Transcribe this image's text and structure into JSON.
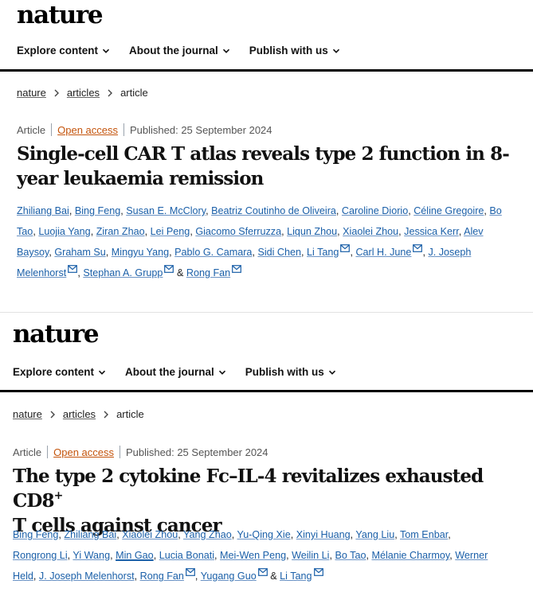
{
  "panels": [
    {
      "logo": "nature",
      "nav": [
        "Explore content",
        "About the journal",
        "Publish with us"
      ],
      "breadcrumb": [
        "nature",
        "articles",
        "article"
      ],
      "article_type": "Article",
      "access": "Open access",
      "published": "Published: 25 September 2024",
      "title": "Single-cell CAR T atlas reveals type 2 function in 8-year leukaemia remission",
      "authors_line1": [
        "Zhiliang Bai",
        "Bing Feng",
        "Susan E. McClory",
        "Beatriz Coutinho de Oliveira",
        "Caroline Diorio",
        "Céline Gregoire",
        "Bo"
      ],
      "authors_line2": [
        "Tao",
        "Luojia Yang",
        "Ziran Zhao",
        "Lei Peng",
        "Giacomo Sferruzza",
        "Liqun Zhou",
        "Xiaolei Zhou",
        "Jessica Kerr",
        "Alev"
      ],
      "authors_line3": [
        "Baysoy",
        "Graham Su",
        "Mingyu Yang",
        "Pablo G. Camara",
        "Sidi Chen",
        "Li Tang",
        "Carl H. June",
        "J. Joseph"
      ],
      "authors_line4": [
        "Melenhorst",
        "Stephan A. Grupp",
        "Rong Fan"
      ],
      "ampersand": "&"
    },
    {
      "logo": "nature",
      "nav": [
        "Explore content",
        "About the journal",
        "Publish with us"
      ],
      "breadcrumb": [
        "nature",
        "articles",
        "article"
      ],
      "article_type": "Article",
      "access": "Open access",
      "published": "Published: 25 September 2024",
      "title_line1": "The type 2 cytokine Fc–IL-4 revitalizes exhausted CD8",
      "title_sup": "+",
      "title_line2": "T cells against cancer",
      "authors_line1": [
        "Bing Feng",
        "Zhiliang Bai",
        "Xiaolei Zhou",
        "Yang Zhao",
        "Yu-Qing Xie",
        "Xinyi Huang",
        "Yang Liu",
        "Tom Enbar"
      ],
      "authors_line2": [
        "Rongrong Li",
        "Yi Wang",
        "Min Gao",
        "Lucia Bonati",
        "Mei-Wen Peng",
        "Weilin Li",
        "Bo Tao",
        "Mélanie Charmoy",
        "Werner"
      ],
      "authors_line3": [
        "Held",
        "J. Joseph Melenhorst",
        "Rong Fan",
        "Yugang Guo",
        "Li Tang"
      ],
      "ampersand": "&"
    }
  ],
  "colors": {
    "link": "#1a5fa8",
    "open_access": "#c4540c",
    "rule": "#000000"
  },
  "icons": {
    "chevron": "chevron-down-icon",
    "separator": "chevron-right-icon",
    "email": "email-icon"
  }
}
